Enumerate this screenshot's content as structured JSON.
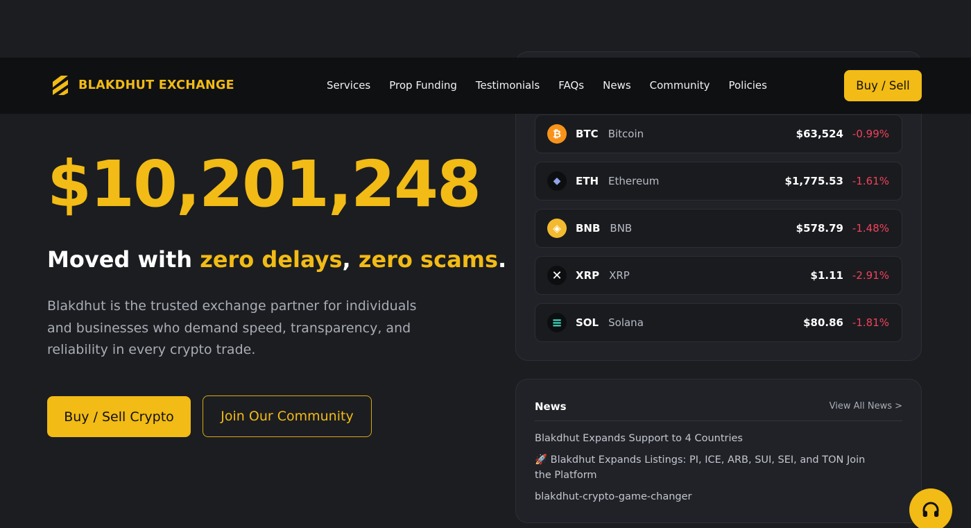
{
  "brand": {
    "name": "BLAKDHUT EXCHANGE",
    "accent": "#f2bb15"
  },
  "nav": {
    "links": [
      "Services",
      "Prop Funding",
      "Testimonials",
      "FAQs",
      "News",
      "Community",
      "Policies"
    ],
    "cta": "Buy / Sell"
  },
  "hero": {
    "amount": "$10,201,248",
    "headline_start": "Moved with ",
    "headline_accent1": "zero delays",
    "headline_comma": ", ",
    "headline_accent2": "zero scams",
    "headline_end": ".",
    "description": "Blakdhut is the trusted exchange partner for individuals and businesses who demand speed, transparency, and reliability in every crypto trade.",
    "primary_button": "Buy / Sell Crypto",
    "secondary_button": "Join Our Community"
  },
  "prices": {
    "coins": [
      {
        "symbol": "BTC",
        "name": "Bitcoin",
        "price": "$63,524",
        "change": "-0.99%",
        "icon": "bitcoin-icon",
        "icon_glyph": "₿",
        "icon_bg": "#f7931a",
        "icon_fg": "#ffffff"
      },
      {
        "symbol": "ETH",
        "name": "Ethereum",
        "price": "$1,775.53",
        "change": "-1.61%",
        "icon": "ethereum-icon",
        "icon_glyph": "◆",
        "icon_bg": "#0d0e10",
        "icon_fg": "#8ea5e8"
      },
      {
        "symbol": "BNB",
        "name": "BNB",
        "price": "$578.79",
        "change": "-1.48%",
        "icon": "bnb-icon",
        "icon_glyph": "◈",
        "icon_bg": "#f3ba2f",
        "icon_fg": "#ffffff"
      },
      {
        "symbol": "XRP",
        "name": "XRP",
        "price": "$1.11",
        "change": "-2.91%",
        "icon": "xrp-icon",
        "icon_glyph": "✕",
        "icon_bg": "#0d0e10",
        "icon_fg": "#ffffff"
      },
      {
        "symbol": "SOL",
        "name": "Solana",
        "price": "$80.86",
        "change": "-1.81%",
        "icon": "solana-icon",
        "icon_glyph": "≡",
        "icon_bg": "#0d0e10",
        "icon_fg": "#3ee0c8"
      }
    ],
    "negative_color": "#f0435a"
  },
  "news": {
    "title": "News",
    "view_all": "View All News >",
    "items": [
      "Blakdhut Expands Support to 4 Countries",
      "🚀 Blakdhut Expands Listings: PI, ICE, ARB, SUI, SEI, and TON Join the Platform",
      "blakdhut-crypto-game-changer"
    ]
  },
  "support": {
    "icon": "headphones-icon"
  }
}
